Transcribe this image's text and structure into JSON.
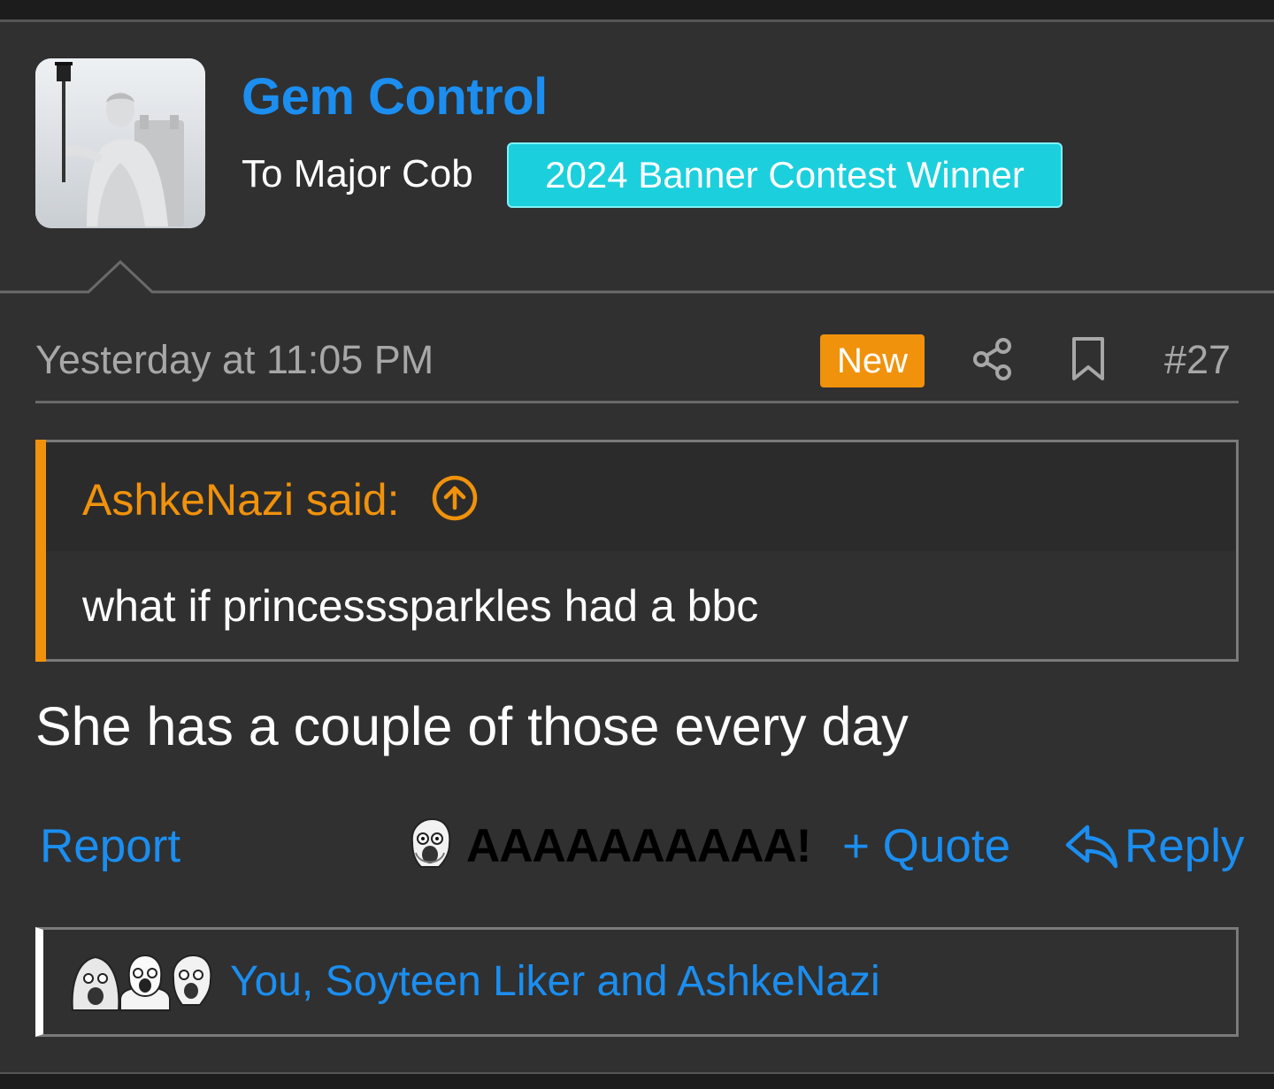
{
  "post": {
    "author": "Gem Control",
    "user_title": "To Major Cob",
    "banner": "2024 Banner Contest Winner",
    "timestamp": "Yesterday at 11:05 PM",
    "new_badge": "New",
    "post_number": "#27",
    "quote": {
      "author_label": "AshkeNazi said:",
      "text": "what if princesssparkles had a bbc"
    },
    "body": "She has a couple of those every day"
  },
  "actions": {
    "report": "Report",
    "reaction": "AAAAAAAAAA!",
    "quote": "+ Quote",
    "reply": "Reply"
  },
  "reactions": {
    "summary": "You, Soyteen Liker and AshkeNazi"
  },
  "icons": {
    "share": "share-icon",
    "bookmark": "bookmark-icon",
    "quote_jump": "arrow-up-circle-icon",
    "reply": "reply-arrow-icon"
  },
  "colors": {
    "link": "#1b8ef0",
    "accent_orange": "#f0920c",
    "banner": "#1ccfdd",
    "background": "#303030"
  }
}
